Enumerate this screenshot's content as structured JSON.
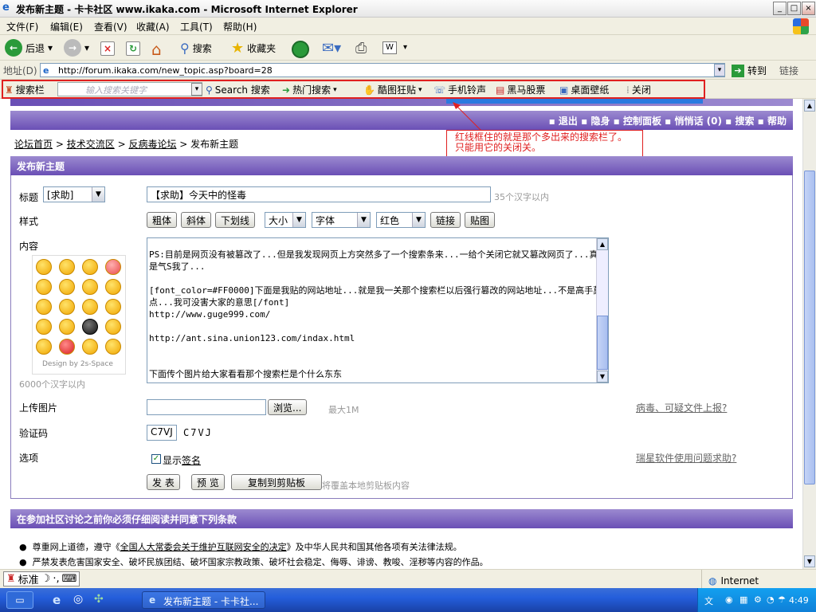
{
  "window": {
    "title": "发布新主题 - 卡卡社区 www.ikaka.com  - Microsoft Internet Explorer"
  },
  "menu": [
    "文件(F)",
    "编辑(E)",
    "查看(V)",
    "收藏(A)",
    "工具(T)",
    "帮助(H)"
  ],
  "toolbar": {
    "back": "后退",
    "search": "搜索",
    "favorites": "收藏夹"
  },
  "address": {
    "label": "地址(D)",
    "url": "http://forum.ikaka.com/new_topic.asp?board=28",
    "go": "转到",
    "links": "链接"
  },
  "searchbar": {
    "name": "搜索栏",
    "placeholder": "输入搜索关键字",
    "search": "Search 搜索",
    "hot": "热门搜索",
    "cool": "酷图狂贴",
    "ring": "手机铃声",
    "stock": "黑马股票",
    "wall": "桌面壁纸",
    "close": "关闭"
  },
  "nav": {
    "logout": "退出",
    "hide": "隐身",
    "panel": "控制面板",
    "msg": "悄悄话 (0)",
    "search": "搜索",
    "help": "帮助"
  },
  "annotation": "红线框住的就是那个多出来的搜索栏了。只能用它的关闭关。",
  "breadcrumb": {
    "home": "论坛首页",
    "tech": "技术交流区",
    "antivirus": "反病毒论坛",
    "current": "发布新主题"
  },
  "form": {
    "heading": "发布新主题",
    "title_label": "标题",
    "title_type": "[求助]",
    "title_value": "【求助】今天中的怪毒",
    "title_hint": "35个汉字以内",
    "style_label": "样式",
    "bold": "粗体",
    "italic": "斜体",
    "underline": "下划线",
    "size": "大小",
    "font": "字体",
    "color": "红色",
    "link": "链接",
    "image": "贴图",
    "content_label": "内容",
    "content": "PS:目前是网页没有被篡改了...但是我发现网页上方突然多了一个搜索条来...一给个关闭它就又篡改网页了...真是气S我了...\n\n[font_color=#FF0000]下面是我贴的网站地址...就是我一关那个搜索栏以后强行篡改的网站地址...不是高手莫点...我可没害大家的意思[/font]\nhttp://www.guge999.com/\n\nhttp://ant.sina.union123.com/indax.html\n\n\n下面传个图片给大家看看那个搜索栏是个什么东东",
    "smiley_credit": "Design by 2s-Space",
    "content_limit": "6000个汉字以内",
    "upload_label": "上传图片",
    "browse": "浏览...",
    "upload_max": "最大1M",
    "report_link": "病毒、可疑文件上报?",
    "captcha_label": "验证码",
    "captcha_value": "C7VJ",
    "captcha_image": "C7VJ",
    "options_label": "选项",
    "show_sig_prefix": "显示",
    "show_sig_link": "签名",
    "help_link": "瑞星软件使用问题求助?",
    "submit": "发 表",
    "preview": "预 览",
    "copy": "复制到剪贴板",
    "copy_hint": "将覆盖本地剪贴板内容"
  },
  "terms": {
    "heading": "在参加社区讨论之前你必须仔细阅读并同意下列条款",
    "t1_prefix": "尊重网上道德，遵守《",
    "t1_link": "全国人大常委会关于维护互联网安全的决定",
    "t1_suffix": "》及中华人民共和国其他各项有关法律法规。",
    "t2": "严禁发表危害国家安全、破坏民族团结、破坏国家宗教政策、破坏社会稳定、侮辱、诽谤、教唆、淫秽等内容的作品。"
  },
  "status": {
    "ime": "标准",
    "zone": "Internet"
  },
  "taskbar": {
    "task": "发布新主题 - 卡卡社...",
    "clock": "4:49"
  }
}
